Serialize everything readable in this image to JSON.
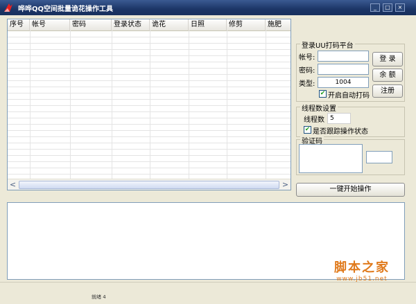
{
  "window": {
    "title": "哗哗QQ空间批量诡花操作工具",
    "minimize_glyph": "_",
    "maximize_glyph": "□",
    "close_glyph": "×"
  },
  "grid": {
    "columns": [
      "序号",
      "帐号",
      "密码",
      "登录状态",
      "诡花",
      "日照",
      "修剪",
      "施肥"
    ],
    "rows": [],
    "scroll_left": "<",
    "scroll_right": ">"
  },
  "login_group": {
    "title": "登录UU打码平台",
    "account_label": "帐号:",
    "account_value": "",
    "password_label": "密码:",
    "password_value": "",
    "type_label": "类型:",
    "type_value": "1004",
    "login_button": "登 录",
    "balance_button": "余 额",
    "register_button": "注册",
    "auto_captcha_label": "开启自动打码",
    "auto_captcha_checked": true
  },
  "thread_group": {
    "title": "线程数设置",
    "thread_label": "线程数",
    "thread_value": "5",
    "track_label": "是否跟踪操作状态",
    "track_checked": true
  },
  "captcha_group": {
    "title": "验证码",
    "input_value": ""
  },
  "start_button": "一键开始操作",
  "log_text": "",
  "status": {
    "text": "就绪 4"
  },
  "watermark": {
    "main": "脚本之家",
    "sub": "www.jb51.net"
  },
  "colors": {
    "titlebar": "#1c3566",
    "window_bg": "#ece9d8",
    "watermark": "#e07a1c"
  }
}
